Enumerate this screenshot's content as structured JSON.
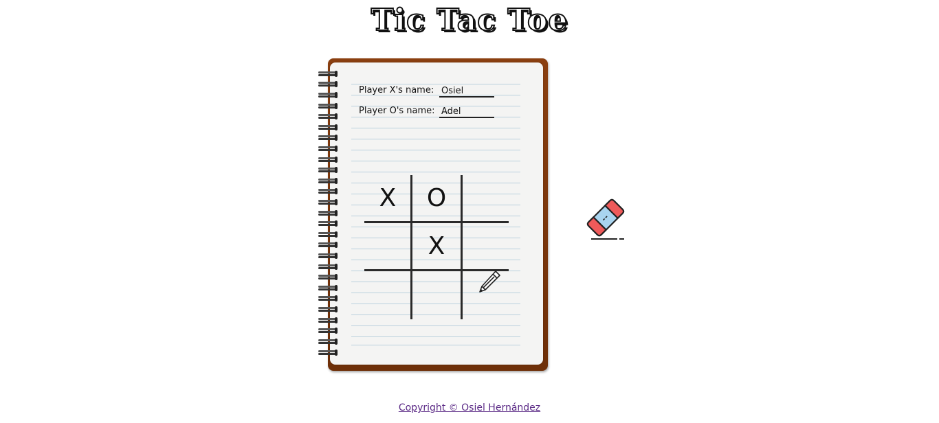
{
  "title": "Tic Tac Toe",
  "players": {
    "x_label": "Player X's name:",
    "x_name": "Osiel",
    "o_label": "Player O's name:",
    "o_name": "Adel"
  },
  "board": {
    "cells": [
      "X",
      "O",
      "",
      "",
      "X",
      "",
      "",
      "",
      ""
    ]
  },
  "tools": {
    "pencil_icon": "pencil-icon",
    "eraser_icon": "eraser-icon"
  },
  "footer": {
    "copyright": "Copyright © Osiel Hernández"
  },
  "colors": {
    "cover": "#7a350c",
    "page": "#f4f4f3",
    "rule": "#b9d0dd",
    "link": "#5b2a86",
    "eraser_red": "#ef5a5a",
    "eraser_blue": "#a9d4ef"
  }
}
